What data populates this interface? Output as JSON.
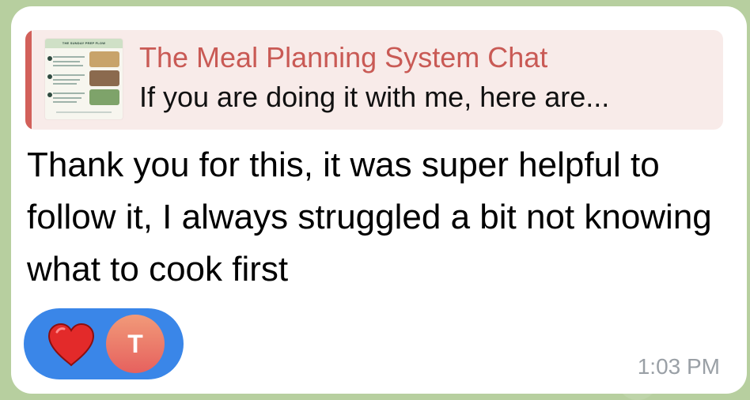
{
  "reply": {
    "thumbnail_title": "THE SUNDAY PREP FLOW",
    "title": "The Meal Planning System Chat",
    "preview": "If you are doing it with me, here are..."
  },
  "message": {
    "text": "Thank you for this, it was super helpful to follow it, I always struggled a bit not knowing what to cook first",
    "time": "1:03 PM"
  },
  "reactions": {
    "emoji": "heart-icon",
    "avatar_initial": "T"
  },
  "colors": {
    "accent_reply": "#d2605a",
    "reply_title": "#c95a55",
    "reaction_pill": "#3a86e8",
    "avatar_gradient_top": "#f19a79",
    "avatar_gradient_bottom": "#e6615e"
  }
}
